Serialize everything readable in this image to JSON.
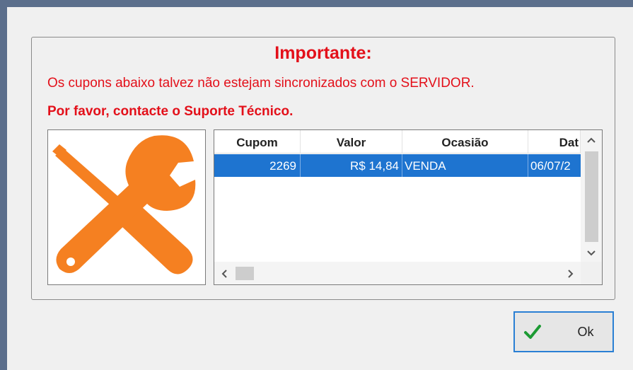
{
  "panel": {
    "title": "Importante:",
    "message_line1": "Os cupons abaixo talvez não estejam sincronizados com o SERVIDOR.",
    "message_line2": "Por favor, contacte o Suporte Técnico."
  },
  "image": {
    "icon": "wrench-screwdriver-icon",
    "color": "#f58021"
  },
  "grid": {
    "columns": [
      "Cupom",
      "Valor",
      "Ocasião",
      "Dat"
    ],
    "rows": [
      {
        "cupom": "2269",
        "valor": "R$ 14,84",
        "ocasiao": "VENDA",
        "data": "06/07/2"
      }
    ],
    "selected_row_color": "#1e74d0"
  },
  "buttons": {
    "ok_label": "Ok"
  },
  "colors": {
    "alert_red": "#e3101a",
    "focus_border": "#2a7fd4",
    "check_green": "#1c9a33"
  }
}
